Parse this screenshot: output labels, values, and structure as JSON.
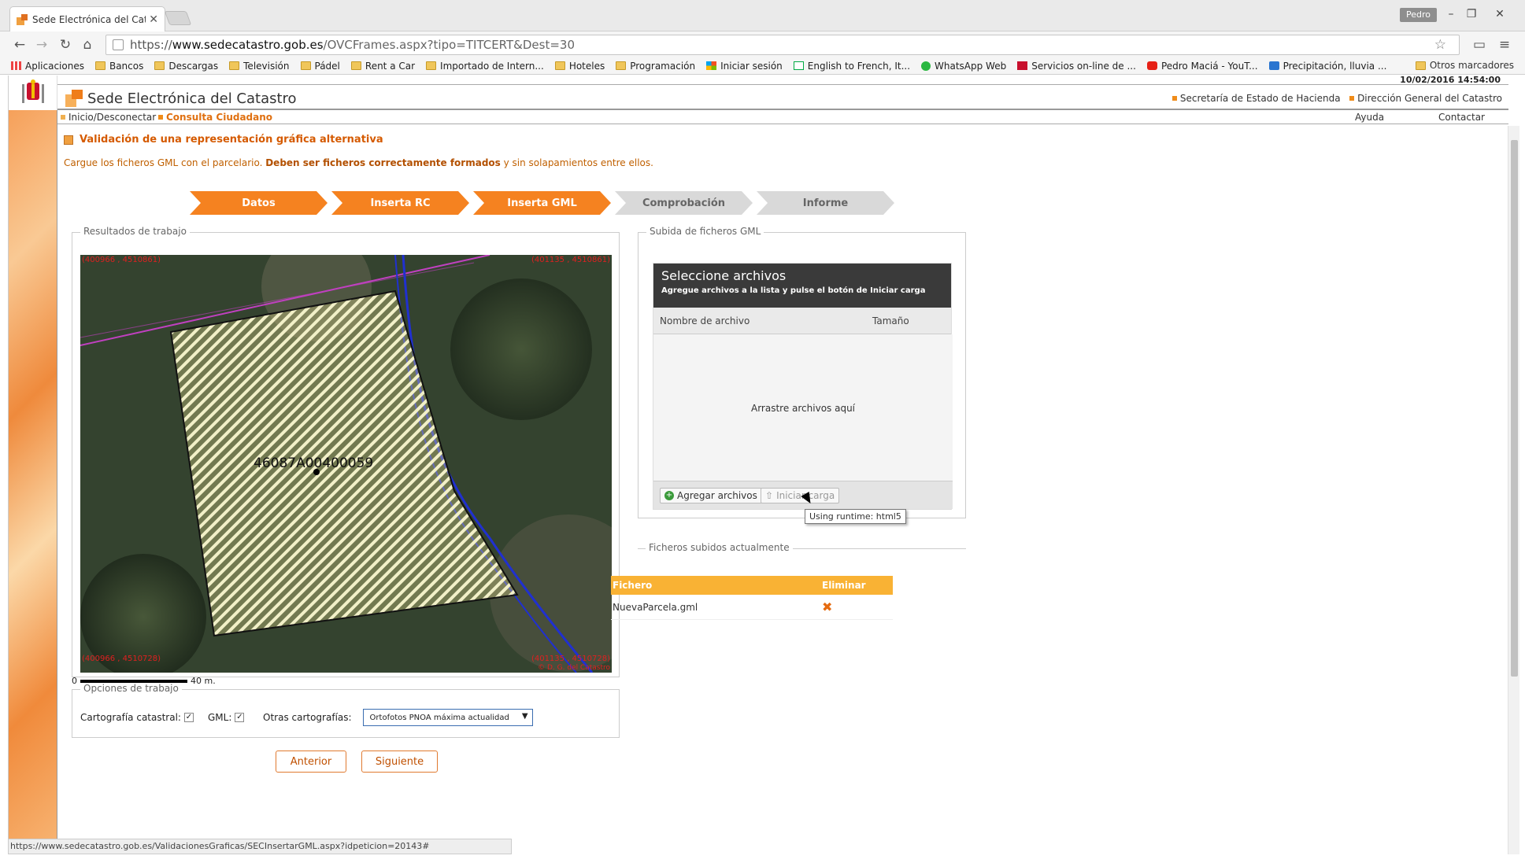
{
  "browser": {
    "tab_title": "Sede Electrónica del Catas",
    "profile": "Pedro",
    "url_scheme": "https://",
    "url_host": "www.sedecatastro.gob.es",
    "url_path": "/OVCFrames.aspx?tipo=TITCERT&Dest=30",
    "bookmarks": [
      "Aplicaciones",
      "Bancos",
      "Descargas",
      "Televisión",
      "Pádel",
      "Rent a Car",
      "Importado de Intern...",
      "Hoteles",
      "Programación",
      "Iniciar sesión",
      "English to French, It...",
      "WhatsApp Web",
      "Servicios on-line de ...",
      "Pedro Maciá - YouT...",
      "Precipitación, lluvia ..."
    ],
    "other_bookmarks": "Otros marcadores",
    "status_url": "https://www.sedecatastro.gob.es/ValidacionesGraficas/SECInsertarGML.aspx?idpeticion=20143#"
  },
  "site": {
    "datetime": "10/02/2016 14:54:00",
    "brand": "Sede Electrónica del Catastro",
    "header_links": [
      "Secretaría de Estado de Hacienda",
      "Dirección General del Catastro"
    ],
    "subnav_left": [
      "Inicio/Desconectar",
      "Consulta Ciudadano"
    ],
    "subnav_right": [
      "Ayuda",
      "Contactar"
    ]
  },
  "page": {
    "title": "Validación de una representación gráfica alternativa",
    "desc_1": "Cargue los ficheros GML con el parcelario. ",
    "desc_bold": "Deben ser ficheros correctamente formados",
    "desc_2": " y sin solapamientos entre ellos.",
    "steps": [
      "Datos",
      "Inserta RC",
      "Inserta GML",
      "Comprobación",
      "Informe"
    ],
    "results_legend": "Resultados de trabajo",
    "map": {
      "coord_tl": "(400966 , 4510861)",
      "coord_tr": "(401135 , 4510861)",
      "coord_bl": "(400966 , 4510728)",
      "coord_br": "(401135 , 4510728)",
      "copyright": "© D. G. del Catastro",
      "parcel_label": "46087A00400059"
    },
    "scale_start": "0",
    "scale_end": "40 m.",
    "options_legend": "Opciones de trabajo",
    "opt_catastral": "Cartografía catastral:",
    "opt_gml": "GML:",
    "opt_otras": "Otras cartografías:",
    "opt_select_value": "Ortofotos PNOA máxima actualidad",
    "btn_prev": "Anterior",
    "btn_next": "Siguiente"
  },
  "upload": {
    "legend": "Subida de ficheros GML",
    "title": "Seleccione archivos",
    "subtitle": "Agregue archivos a la lista y pulse el botón de Iniciar carga",
    "col_name": "Nombre de archivo",
    "col_size": "Tamaño",
    "drop_text": "Arrastre archivos aquí",
    "add_btn": "Agregar archivos",
    "start_btn": "Iniciar carga",
    "tooltip": "Using runtime: html5"
  },
  "uploaded": {
    "legend": "Ficheros subidos actualmente",
    "col_file": "Fichero",
    "col_delete": "Eliminar",
    "files": [
      "NuevaParcela.gml"
    ]
  },
  "colors": {
    "accent": "#f58220",
    "step_idle": "#d9d9d9",
    "table_header": "#f9b234"
  }
}
